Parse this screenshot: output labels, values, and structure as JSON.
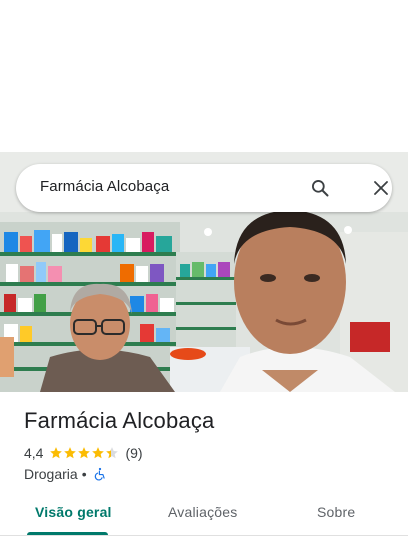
{
  "search": {
    "query": "Farmácia Alcobaça",
    "search_icon": "search-icon",
    "close_icon": "close-icon"
  },
  "photo": {
    "description_icon": "place-photo"
  },
  "place": {
    "name": "Farmácia Alcobaça",
    "rating": "4,4",
    "rating_stars": 4.4,
    "review_count": "(9)",
    "category": "Drogaria",
    "separator": "•",
    "accessibility_icon": "wheelchair-icon"
  },
  "tabs": [
    {
      "label": "Visão geral",
      "active": true
    },
    {
      "label": "Avaliações",
      "active": false
    },
    {
      "label": "Sobre",
      "active": false
    }
  ],
  "colors": {
    "accent": "#00796b",
    "star": "#fbbc04",
    "accessibility": "#1a73e8",
    "text_primary": "#202124",
    "text_secondary": "#3c4043"
  }
}
